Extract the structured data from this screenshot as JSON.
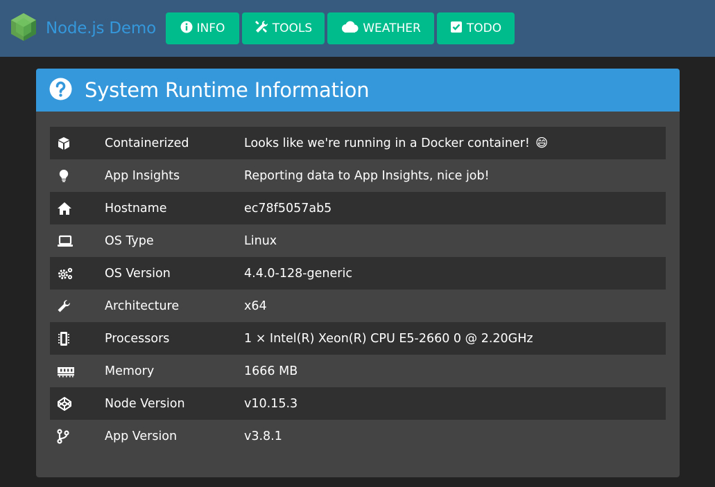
{
  "brand": {
    "name": "Node.js Demo",
    "logo_icon": "nodejs-hexagon-icon",
    "logo_color": "#43a047"
  },
  "nav": [
    {
      "label": "INFO",
      "icon": "info-circle-icon"
    },
    {
      "label": "TOOLS",
      "icon": "tools-icon"
    },
    {
      "label": "WEATHER",
      "icon": "cloud-icon"
    },
    {
      "label": "TODO",
      "icon": "check-square-icon"
    }
  ],
  "card": {
    "title": "System Runtime Information",
    "icon": "question-circle-icon"
  },
  "rows": [
    {
      "icon": "cube-icon",
      "label": "Containerized",
      "value": "Looks like we're running in a Docker container!",
      "emoji": "😄"
    },
    {
      "icon": "lightbulb-icon",
      "label": "App Insights",
      "value": "Reporting data to App Insights, nice job!"
    },
    {
      "icon": "home-icon",
      "label": "Hostname",
      "value": "ec78f5057ab5"
    },
    {
      "icon": "laptop-icon",
      "label": "OS Type",
      "value": "Linux"
    },
    {
      "icon": "cogs-icon",
      "label": "OS Version",
      "value": "4.4.0-128-generic"
    },
    {
      "icon": "wrench-icon",
      "label": "Architecture",
      "value": "x64"
    },
    {
      "icon": "microchip-icon",
      "label": "Processors",
      "value": "1 × Intel(R) Xeon(R) CPU E5-2660 0 @ 2.20GHz"
    },
    {
      "icon": "memory-icon",
      "label": "Memory",
      "value": "1666 MB"
    },
    {
      "icon": "codepen-icon",
      "label": "Node Version",
      "value": "v10.15.3"
    },
    {
      "icon": "code-branch-icon",
      "label": "App Version",
      "value": "v3.8.1"
    }
  ],
  "colors": {
    "navbar": "#375a7f",
    "brand_text": "#3498db",
    "nav_button": "#00bc8c",
    "card_header": "#3498db",
    "card_body": "#444444",
    "row_stripe": "#303030",
    "page_bg": "#222222"
  }
}
